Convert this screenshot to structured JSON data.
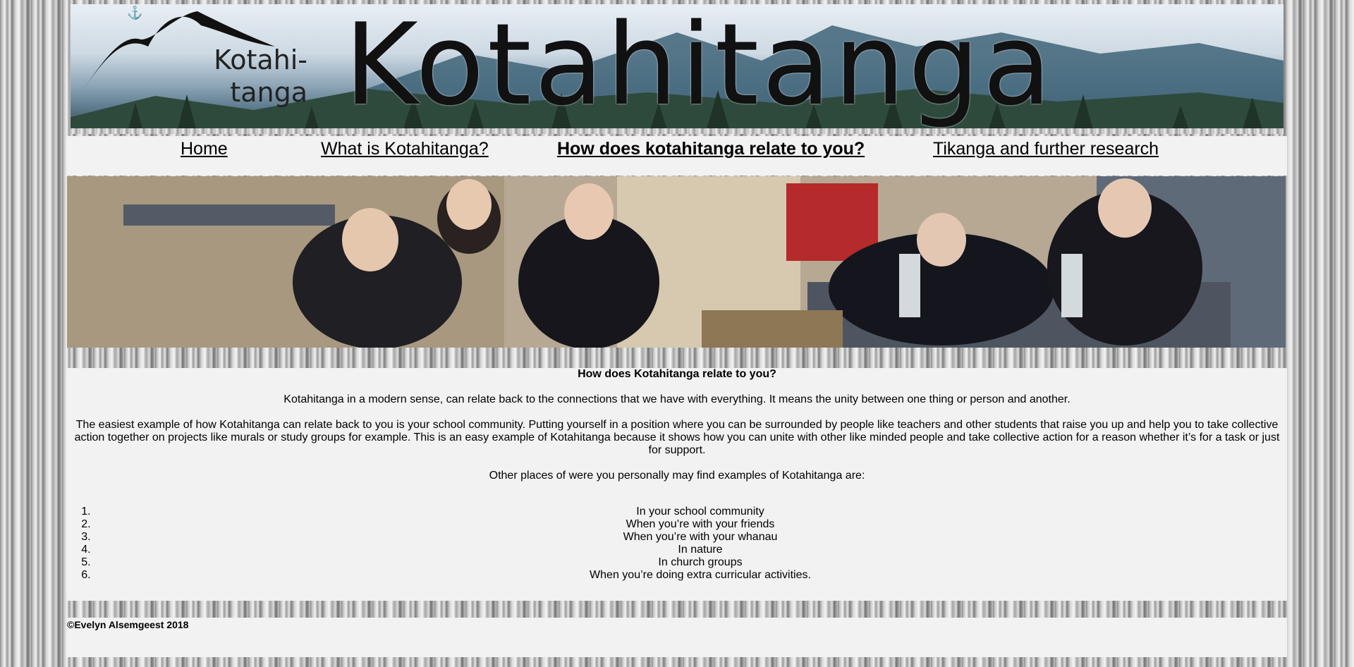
{
  "banner": {
    "logo_line1": "Kotahi-",
    "logo_line2": "tanga",
    "title": "Kotahitanga",
    "anchor_glyph": "⚓"
  },
  "nav": {
    "items": [
      {
        "label": "Home",
        "active": false
      },
      {
        "label": "What is Kotahitanga?",
        "active": false
      },
      {
        "label": "How does kotahitanga relate to you?",
        "active": true
      },
      {
        "label": "Tikanga and further research",
        "active": false
      }
    ]
  },
  "content": {
    "heading": "How does Kotahitanga relate to you?",
    "p1": "Kotahitanga in a modern sense, can relate back to the connections that we have with everything. It means the unity between one thing or person and another.",
    "p2": "The easiest example of how Kotahitanga can relate back to you is your school community. Putting yourself in a position where you can be surrounded by people like teachers and other students that raise you up and help you to take collective action together on projects like murals or study groups for example. This is an easy example of Kotahitanga because it shows how you can unite with other like minded people and take collective action for a reason whether it’s for a task or just for support.",
    "p3": "Other places of were you personally may find examples of Kotahitanga are:",
    "list": [
      "In your school community",
      "When you’re with your friends",
      "When you’re with your whanau",
      "In nature",
      "In church groups",
      "When you’re doing extra curricular activities."
    ]
  },
  "footer": {
    "copyright": "©Evelyn Alsemgeest 2018"
  }
}
